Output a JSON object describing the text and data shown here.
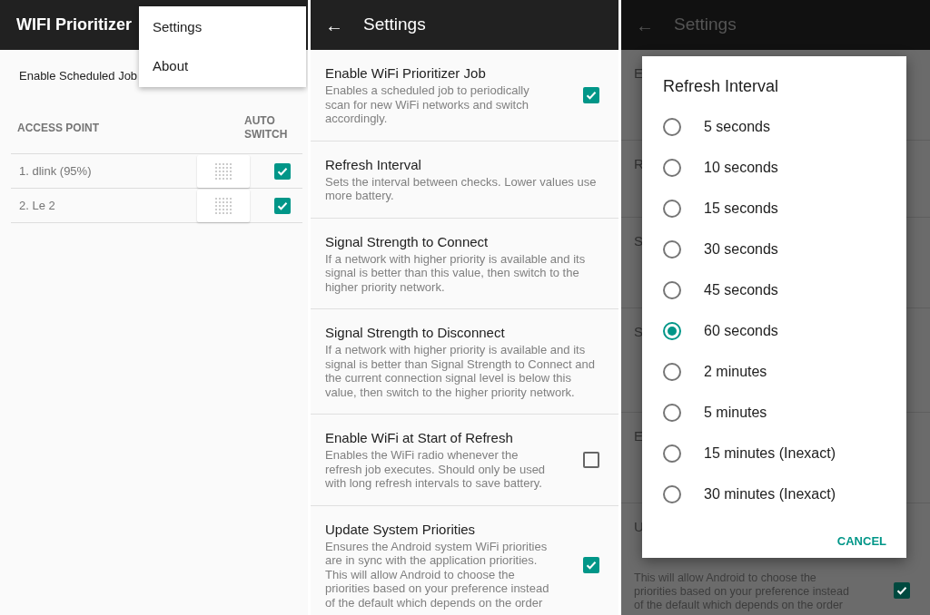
{
  "main_screen": {
    "app_bar": {
      "title": "WIFI Prioritizer"
    },
    "scheduled_job": {
      "label": "Enable Scheduled Job"
    },
    "overflow_menu": {
      "items": [
        {
          "label": "Settings"
        },
        {
          "label": "About"
        }
      ]
    },
    "table": {
      "columns": [
        "ACCESS POINT",
        "AUTO SWITCH"
      ],
      "rows": [
        {
          "name": "1. dlink (95%)",
          "auto_switch": true
        },
        {
          "name": "2. Le 2",
          "auto_switch": true
        }
      ]
    }
  },
  "settings_screen": {
    "app_bar": {
      "back": "←",
      "title": "Settings"
    },
    "items": [
      {
        "title": "Enable WiFi Prioritizer Job",
        "description": "Enables a scheduled job to periodically scan for new WiFi networks and switch accordingly.",
        "kind": "checkbox",
        "checked": true
      },
      {
        "title": "Refresh Interval",
        "description": "Sets the interval between checks. Lower values use more battery.",
        "kind": "plain"
      },
      {
        "title": "Signal Strength to Connect",
        "description": "If a network with higher priority is available and its signal is better than this value, then switch to the higher priority network.",
        "kind": "plain"
      },
      {
        "title": "Signal Strength to Disconnect",
        "description": "If a network with higher priority is available and its signal is better than Signal Strength to Connect and the current connection signal level is below this value, then switch to the higher priority network.",
        "kind": "plain"
      },
      {
        "title": "Enable WiFi at Start of Refresh",
        "description": "Enables the WiFi radio whenever the refresh job executes. Should only be used with long refresh intervals to save battery.",
        "kind": "checkbox",
        "checked": false
      },
      {
        "title": "Update System Priorities",
        "description": "Ensures the Android system WiFi priorities are in sync with the application priorities. This will allow Android to choose the priorities based on your preference instead of the default which depends on the order",
        "kind": "checkbox",
        "checked": true
      }
    ]
  },
  "dialog_screen": {
    "app_bar": {
      "back": "←",
      "title": "Settings"
    },
    "behind_items": [
      {
        "title": "E",
        "kind": "plain"
      },
      {
        "title": "R",
        "kind": "plain"
      },
      {
        "title": "S",
        "kind": "plain"
      },
      {
        "title": "S",
        "kind": "plain"
      },
      {
        "title": "E",
        "kind": "plain"
      },
      {
        "title": "U",
        "kind": "checkbox",
        "checked": true,
        "lines": [
          "This will allow Android to choose the",
          "priorities based on your preference instead",
          "of the default which depends on the order"
        ]
      }
    ],
    "dialog": {
      "title": "Refresh Interval",
      "options": [
        {
          "label": "5 seconds",
          "selected": false
        },
        {
          "label": "10 seconds",
          "selected": false
        },
        {
          "label": "15 seconds",
          "selected": false
        },
        {
          "label": "30 seconds",
          "selected": false
        },
        {
          "label": "45 seconds",
          "selected": false
        },
        {
          "label": "60 seconds",
          "selected": true
        },
        {
          "label": "2 minutes",
          "selected": false
        },
        {
          "label": "5 minutes",
          "selected": false
        },
        {
          "label": "15 minutes (Inexact)",
          "selected": false
        },
        {
          "label": "30 minutes (Inexact)",
          "selected": false
        }
      ],
      "cancel": "CANCEL"
    }
  }
}
